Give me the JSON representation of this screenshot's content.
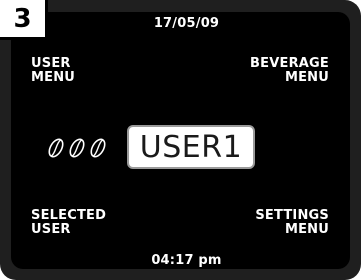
{
  "step": "3",
  "date": "17/05/09",
  "time": "04:17 pm",
  "user_menu": [
    "USER",
    "MENU"
  ],
  "beverage_menu": [
    "BEVERAGE",
    "MENU"
  ],
  "selected_user": [
    "SELECTED",
    "USER"
  ],
  "settings_menu": [
    "SETTINGS",
    "MENU"
  ],
  "current_user": "USER1",
  "strength_icons": [
    "coffee-bean-icon",
    "coffee-bean-icon",
    "coffee-bean-icon"
  ],
  "colors": {
    "screen": "#000000",
    "frame": "#1f1f1f",
    "text": "#ffffff"
  }
}
